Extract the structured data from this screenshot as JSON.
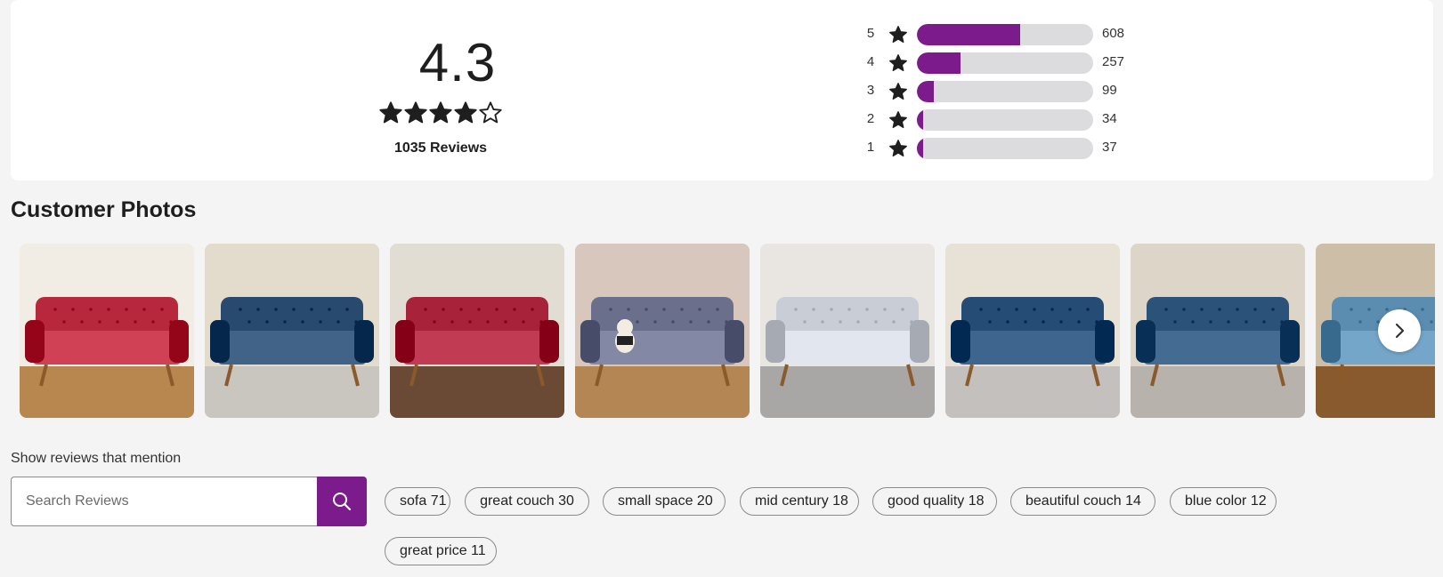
{
  "summary": {
    "average": "4.3",
    "average_value": 4.3,
    "review_count_label": "1035 Reviews",
    "star_color": "#1e1e1e"
  },
  "histogram": {
    "bar_color": "#7b1b8c",
    "track_color": "#dcdcde",
    "rows": [
      {
        "stars": "5",
        "count": "608",
        "fraction": 0.587
      },
      {
        "stars": "4",
        "count": "257",
        "fraction": 0.248
      },
      {
        "stars": "3",
        "count": "99",
        "fraction": 0.096
      },
      {
        "stars": "2",
        "count": "34",
        "fraction": 0.033
      },
      {
        "stars": "1",
        "count": "37",
        "fraction": 0.036
      }
    ]
  },
  "photos": {
    "heading": "Customer Photos",
    "items": [
      {
        "subject": "red sofa",
        "color": "#b8283c",
        "wall": "#f1ece4",
        "floor": "#b7874f"
      },
      {
        "subject": "blue sofa",
        "color": "#274a6e",
        "wall": "#e3dccd",
        "floor": "#c9c5bf"
      },
      {
        "subject": "red sofa",
        "color": "#a8233a",
        "wall": "#e2ddd3",
        "floor": "#6b4a35"
      },
      {
        "subject": "gray sofa with dog",
        "color": "#6a6f8c",
        "wall": "#d7c7bd",
        "floor": "#b38654"
      },
      {
        "subject": "light gray sofa",
        "color": "#c9ced6",
        "wall": "#e9e6e1",
        "floor": "#a9a7a6"
      },
      {
        "subject": "blue sofa",
        "color": "#254c75",
        "wall": "#e8e2d6",
        "floor": "#c3c0bd"
      },
      {
        "subject": "blue sofa",
        "color": "#2b5278",
        "wall": "#dcd5c8",
        "floor": "#b7b2ab"
      },
      {
        "subject": "light blue sofa",
        "color": "#5b8db0",
        "wall": "#cdbfa7",
        "floor": "#8a5a2f"
      }
    ],
    "next_icon": "chevron-right-icon"
  },
  "mentions": {
    "label": "Show reviews that mention",
    "search_placeholder": "Search Reviews",
    "search_icon": "search-icon",
    "accent": "#7b1b8c",
    "chips": [
      "sofa 71",
      "great couch 30",
      "small space 20",
      "mid century 18",
      "good quality 18",
      "beautiful couch 14",
      "blue color 12",
      "great price 11"
    ]
  }
}
